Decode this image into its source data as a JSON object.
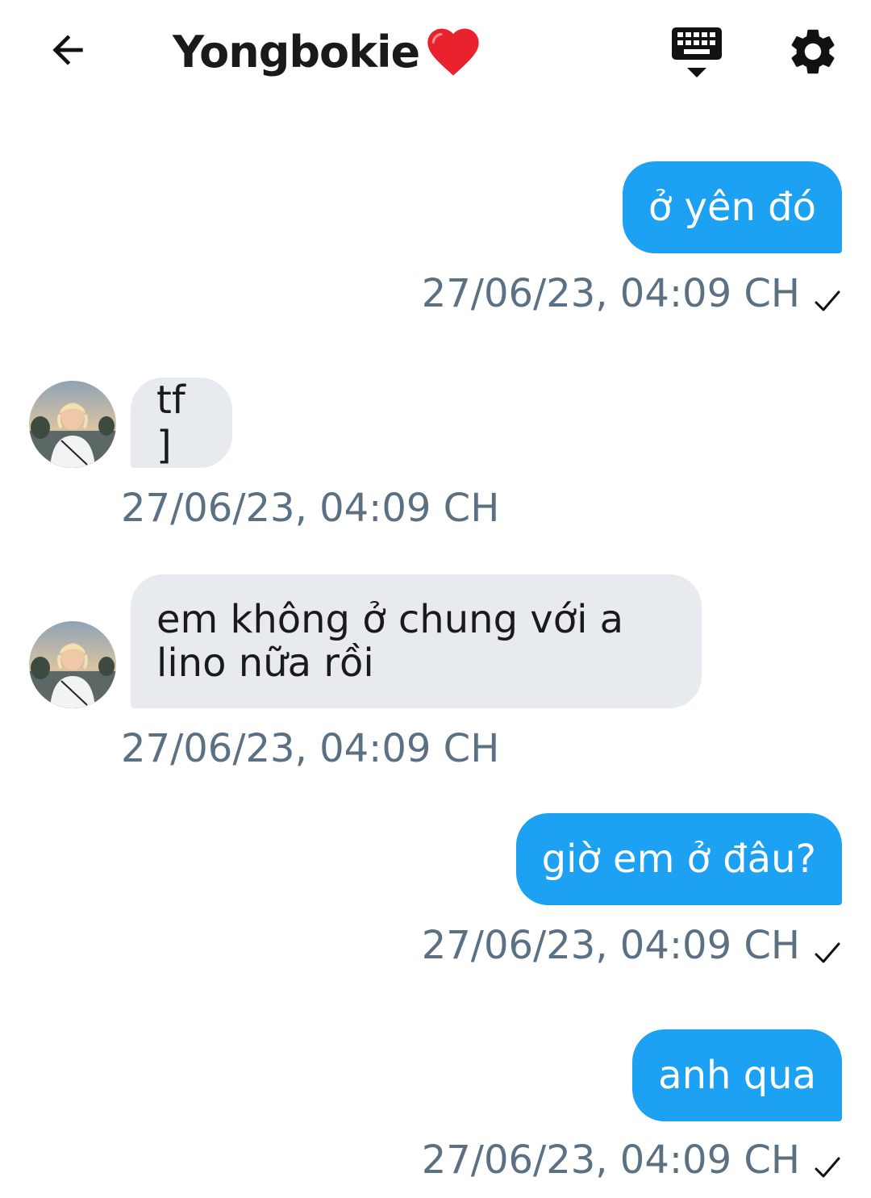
{
  "header": {
    "title": "Yongbokie",
    "back_icon": "arrow-left-icon",
    "keyboard_icon": "keyboard-hide-icon",
    "settings_icon": "gear-icon",
    "heart_icon": "red-heart-emoji"
  },
  "colors": {
    "outgoing_bubble": "#1da1f2",
    "incoming_bubble": "#e7ebef",
    "timestamp": "#5b7083"
  },
  "messages": [
    {
      "direction": "out",
      "text": "ở yên đó",
      "time": "27/06/23, 04:09 CH",
      "sent": true
    },
    {
      "direction": "in",
      "text": "tf ]",
      "time": "27/06/23, 04:09 CH"
    },
    {
      "direction": "in",
      "text": "em không ở chung với a lino nữa rồi",
      "time": "27/06/23, 04:09 CH"
    },
    {
      "direction": "out",
      "text": "giờ em ở đâu?",
      "time": "27/06/23, 04:09 CH",
      "sent": true
    },
    {
      "direction": "out",
      "text": "anh qua",
      "time": "27/06/23, 04:09 CH",
      "sent": true
    }
  ]
}
